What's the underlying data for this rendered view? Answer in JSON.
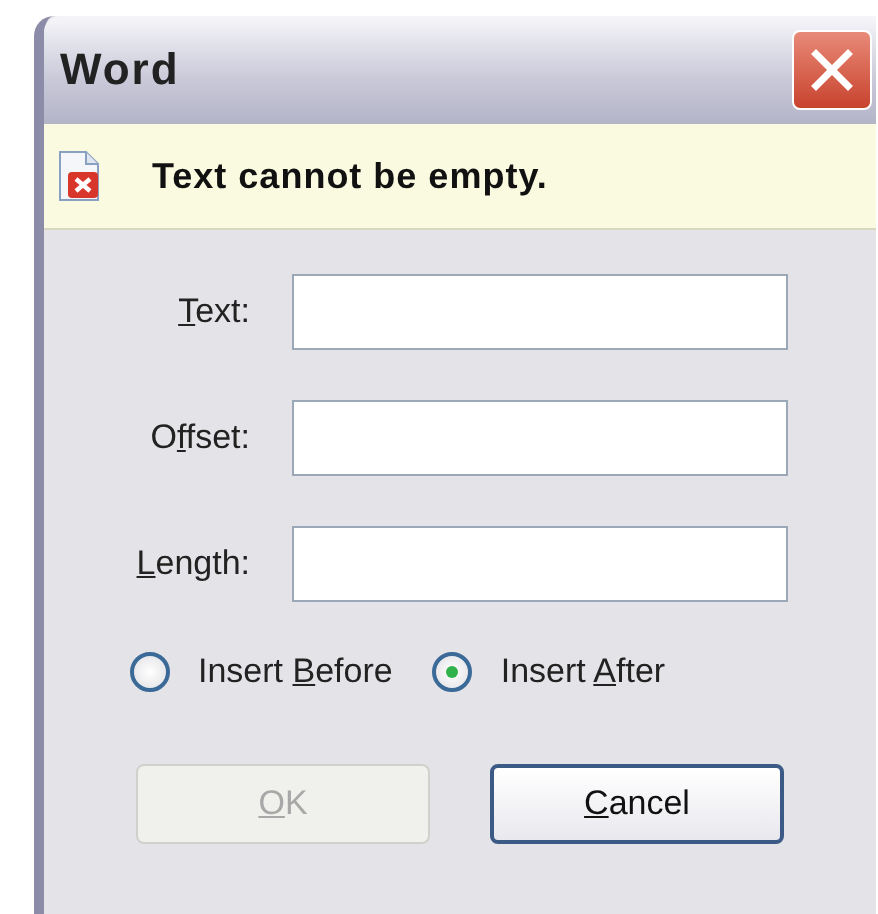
{
  "window": {
    "title": "Word"
  },
  "message": {
    "kind": "error",
    "text": "Text cannot be empty."
  },
  "fields": [
    {
      "label": [
        {
          "text": "T",
          "underline": true
        },
        {
          "text": "ext:",
          "underline": false
        }
      ]
    },
    {
      "label": [
        {
          "text": "O",
          "underline": false
        },
        {
          "text": "f",
          "underline": true
        },
        {
          "text": "fset:",
          "underline": false
        }
      ]
    },
    {
      "label": [
        {
          "text": "L",
          "underline": true
        },
        {
          "text": "ength:",
          "underline": false
        }
      ]
    }
  ],
  "options": [
    {
      "label": [
        {
          "text": "Insert ",
          "underline": false
        },
        {
          "text": "B",
          "underline": true
        },
        {
          "text": "efore",
          "underline": false
        }
      ],
      "selected": false
    },
    {
      "label": [
        {
          "text": "Insert ",
          "underline": false
        },
        {
          "text": "A",
          "underline": true
        },
        {
          "text": "fter",
          "underline": false
        }
      ],
      "selected": true
    }
  ],
  "buttons": [
    {
      "label": [
        {
          "text": "O",
          "underline": true
        },
        {
          "text": "K",
          "underline": false
        }
      ],
      "disabled": true
    },
    {
      "label": [
        {
          "text": "C",
          "underline": true
        },
        {
          "text": "ancel",
          "underline": false
        }
      ],
      "disabled": false
    }
  ]
}
